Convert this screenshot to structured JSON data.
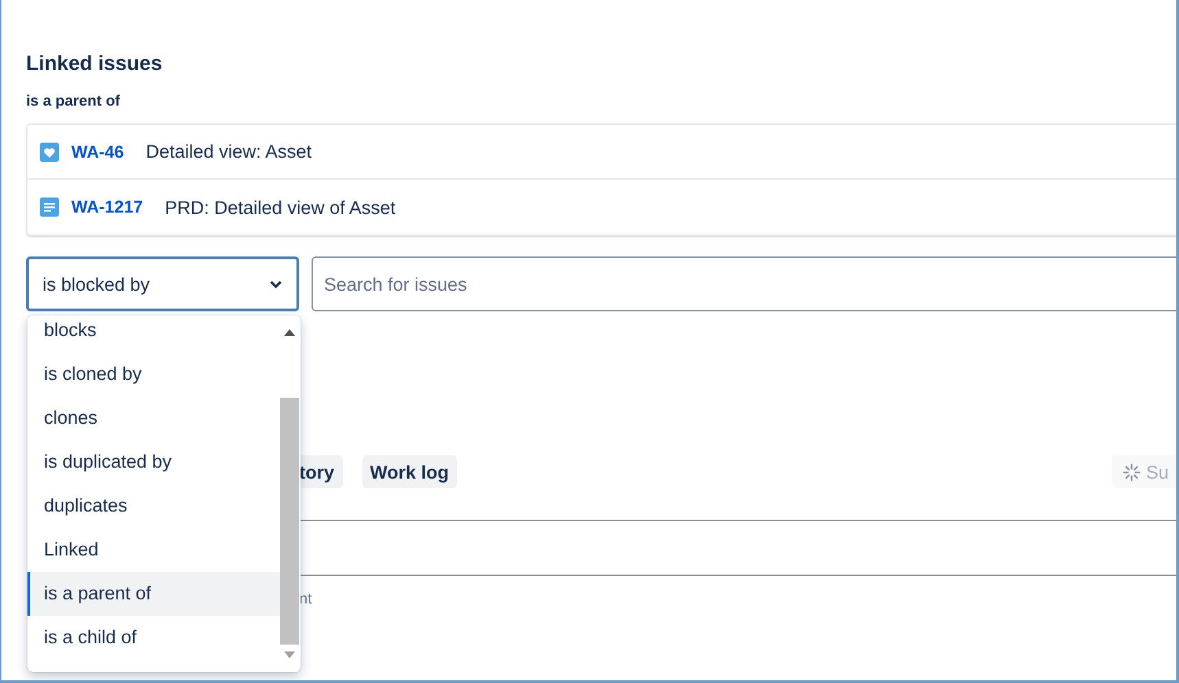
{
  "section": {
    "title": "Linked issues",
    "group_label": "is a parent of"
  },
  "issues": [
    {
      "key": "WA-46",
      "summary": "Detailed view: Asset",
      "kind": "story"
    },
    {
      "key": "WA-1217",
      "summary": "PRD: Detailed view of Asset",
      "kind": "document"
    }
  ],
  "link_type_select": {
    "value": "is blocked by",
    "expanded": true
  },
  "search": {
    "placeholder": "Search for issues"
  },
  "link_type_options": [
    {
      "label": "blocks",
      "selected": false
    },
    {
      "label": "is cloned by",
      "selected": false
    },
    {
      "label": "clones",
      "selected": false
    },
    {
      "label": "is duplicated by",
      "selected": false
    },
    {
      "label": "duplicates",
      "selected": false
    },
    {
      "label": "Linked",
      "selected": false
    },
    {
      "label": "is a parent of",
      "selected": true
    },
    {
      "label": "is a child of",
      "selected": false
    }
  ],
  "activity_tabs": [
    "tory",
    "Work log"
  ],
  "summarize_button": {
    "label": "Su",
    "disabled": true
  },
  "hidden_text": "nt"
}
